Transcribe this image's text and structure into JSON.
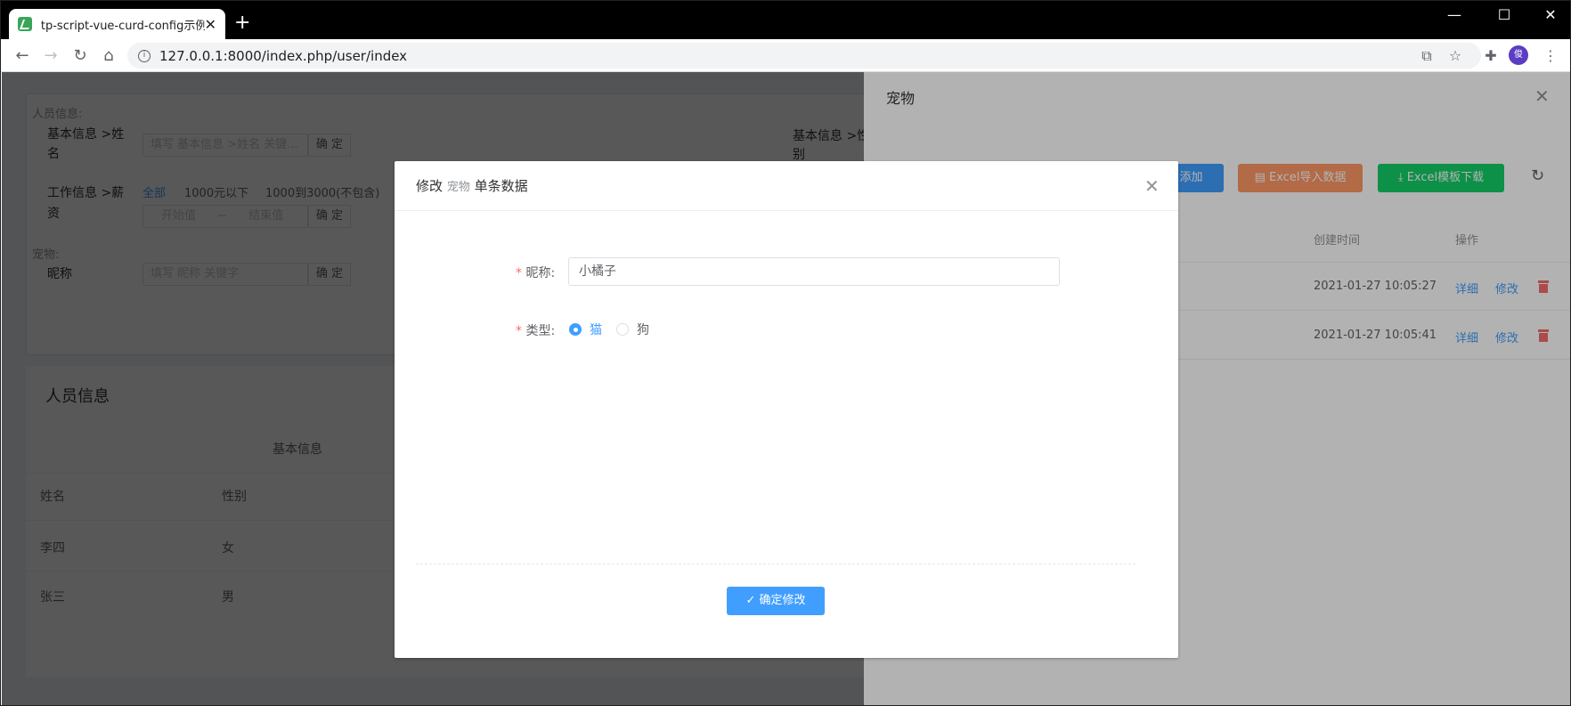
{
  "browser": {
    "tab_title": "tp-script-vue-curd-config示例",
    "tab_close": "✕",
    "new_tab": "+",
    "url": "127.0.0.1:8000/index.php/user/index",
    "avatar_text": "俊"
  },
  "search": {
    "section_person": "人员信息:",
    "name_label_1": "基本信息 >姓",
    "name_label_2": "名",
    "name_placeholder": "填写 基本信息 >姓名 关键...",
    "confirm": "确 定",
    "gender_label_1": "基本信息 >性",
    "gender_label_2": "别",
    "salary_label_1": "工作信息 >薪",
    "salary_label_2": "资",
    "salary_opt_all": "全部",
    "salary_opt_1": "1000元以下",
    "salary_opt_2": "1000到3000(不包含)",
    "salary_start": "开始值",
    "salary_tilde": "~",
    "salary_end": "结束值",
    "section_pet": "宠物:",
    "nick_label": "昵称",
    "nick_placeholder": "填写 昵称 关键字"
  },
  "person_table": {
    "title": "人员信息",
    "group_header": "基本信息",
    "col_name": "姓名",
    "col_gender": "性别",
    "rows": [
      {
        "name": "李四",
        "gender": "女"
      },
      {
        "name": "张三",
        "gender": "男"
      }
    ]
  },
  "drawer": {
    "title": "宠物",
    "btn_add": "添加",
    "btn_import": "Excel导入数据",
    "btn_template": "Excel模板下载",
    "col_created": "创建时间",
    "col_ops": "操作",
    "rows": [
      {
        "created": "2021-01-27 10:05:27",
        "detail": "详细",
        "edit": "修改"
      },
      {
        "created": "2021-01-27 10:05:41",
        "detail": "详细",
        "edit": "修改"
      }
    ]
  },
  "dialog": {
    "title_prefix": "修改",
    "title_model": "宠物",
    "title_suffix": "单条数据",
    "nick_label": "昵称:",
    "nick_value": "小橘子",
    "type_label": "类型:",
    "type_options": [
      "猫",
      "狗"
    ],
    "type_selected": "猫",
    "submit": "确定修改"
  },
  "colors": {
    "primary": "#409eff",
    "success": "#13ce66",
    "warning": "#ff9966",
    "danger": "#f56c6c"
  }
}
